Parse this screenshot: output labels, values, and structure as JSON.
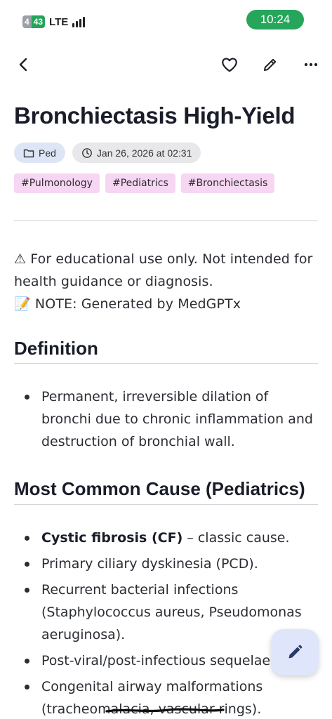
{
  "status_bar": {
    "battery_left": "4",
    "battery_right": "43",
    "network": "LTE",
    "time": "10:24"
  },
  "app_bar": {
    "back_icon": "chevron-left-icon",
    "favorite_icon": "heart-outline-icon",
    "edit_icon": "pencil-icon",
    "more_icon": "more-horizontal-icon"
  },
  "note": {
    "title": "Bronchiectasis High-Yield",
    "folder": "Ped",
    "date": "Jan 26, 2026 at 02:31",
    "tags": [
      "#Pulmonology",
      "#Pediatrics",
      "#Bronchiectasis"
    ]
  },
  "disclaimer": {
    "line1": "⚠ For educational use only. Not intended for health guidance or diagnosis.",
    "line2": "📝 NOTE: Generated by MedGPTx"
  },
  "sections": {
    "definition": {
      "heading": "Definition",
      "items": [
        "Permanent, irreversible dilation of bronchi due to chronic inflammation and destruction of bronchial wall."
      ]
    },
    "causes": {
      "heading": "Most Common Cause (Pediatrics)",
      "item1_bold": "Cystic fibrosis (CF)",
      "item1_rest": " – classic cause.",
      "items": [
        "Primary ciliary dyskinesia (PCD).",
        "Recurrent bacterial infections (Staphylococcus aureus, Pseudomonas aeruginosa).",
        "Post-viral/post-infectious sequelae.",
        "Congenital airway malformations (tracheomalacia, vascular rings)."
      ]
    }
  },
  "fab": {
    "icon": "pencil-icon"
  },
  "colors": {
    "clock_pill": "#26a65b",
    "tag_bg": "#f6d6f3",
    "folder_chip_bg": "#dde6f6",
    "date_chip_bg": "#e8e8ea",
    "fab_bg": "#dfe6fb"
  }
}
